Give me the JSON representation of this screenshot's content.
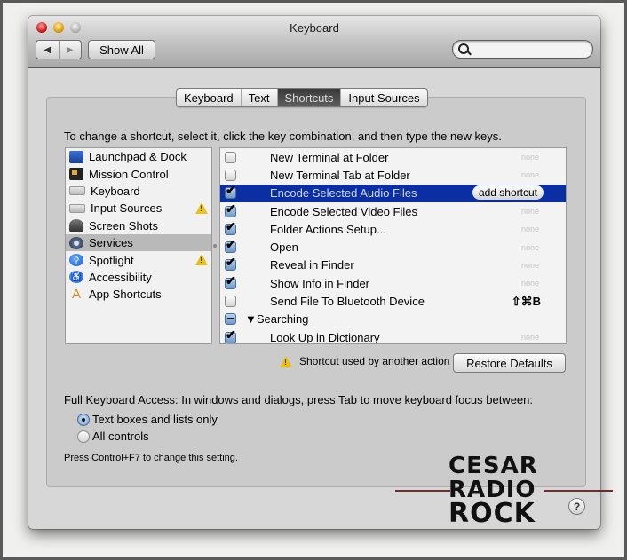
{
  "window": {
    "title": "Keyboard",
    "show_all_label": "Show All",
    "back_icon": "◀",
    "forward_icon": "▶",
    "search_placeholder": ""
  },
  "tabs": [
    {
      "label": "Keyboard",
      "active": false
    },
    {
      "label": "Text",
      "active": false
    },
    {
      "label": "Shortcuts",
      "active": true
    },
    {
      "label": "Input Sources",
      "active": false
    }
  ],
  "instructions": "To change a shortcut, select it, click the key combination, and then type the new keys.",
  "categories": [
    {
      "label": "Launchpad & Dock",
      "icon": "launchpad-icon",
      "warning": false,
      "selected": false
    },
    {
      "label": "Mission Control",
      "icon": "mission-control-icon",
      "warning": false,
      "selected": false
    },
    {
      "label": "Keyboard",
      "icon": "keyboard-icon",
      "warning": false,
      "selected": false
    },
    {
      "label": "Input Sources",
      "icon": "keyboard-icon",
      "warning": true,
      "selected": false
    },
    {
      "label": "Screen Shots",
      "icon": "camera-icon",
      "warning": false,
      "selected": false
    },
    {
      "label": "Services",
      "icon": "gear-icon",
      "warning": false,
      "selected": true
    },
    {
      "label": "Spotlight",
      "icon": "spotlight-icon",
      "warning": true,
      "selected": false
    },
    {
      "label": "Accessibility",
      "icon": "accessibility-icon",
      "warning": false,
      "selected": false
    },
    {
      "label": "App Shortcuts",
      "icon": "app-shortcuts-icon",
      "warning": false,
      "selected": false
    }
  ],
  "shortcuts": [
    {
      "label": "New Terminal at Folder",
      "checked": "off",
      "key": "none",
      "selected": false
    },
    {
      "label": "New Terminal Tab at Folder",
      "checked": "off",
      "key": "none",
      "selected": false
    },
    {
      "label": "Encode Selected Audio Files",
      "checked": "on",
      "key": "add shortcut",
      "selected": true
    },
    {
      "label": "Encode Selected Video Files",
      "checked": "on",
      "key": "none",
      "selected": false
    },
    {
      "label": "Folder Actions Setup...",
      "checked": "on",
      "key": "none",
      "selected": false
    },
    {
      "label": "Open",
      "checked": "on",
      "key": "none",
      "selected": false
    },
    {
      "label": "Reveal in Finder",
      "checked": "on",
      "key": "none",
      "selected": false
    },
    {
      "label": "Show Info in Finder",
      "checked": "on",
      "key": "none",
      "selected": false
    },
    {
      "label": "Send File To Bluetooth Device",
      "checked": "off",
      "key": "⇧⌘B",
      "selected": false
    },
    {
      "label": "▼Searching",
      "checked": "mixed",
      "key": "",
      "selected": false,
      "group": true
    },
    {
      "label": "Look Up in Dictionary",
      "checked": "on",
      "key": "none",
      "selected": false
    }
  ],
  "conflict_text": "Shortcut used by another action",
  "restore_defaults_label": "Restore Defaults",
  "full_keyboard_access": {
    "label": "Full Keyboard Access: In windows and dialogs, press Tab to move keyboard focus between:",
    "options": [
      {
        "label": "Text boxes and lists only",
        "selected": true
      },
      {
        "label": "All controls",
        "selected": false
      }
    ],
    "hint": "Press Control+F7 to change this setting."
  },
  "help_label": "?",
  "watermark": {
    "line1": "CESAR",
    "line2": "RADIO",
    "line3": "ROCK"
  }
}
